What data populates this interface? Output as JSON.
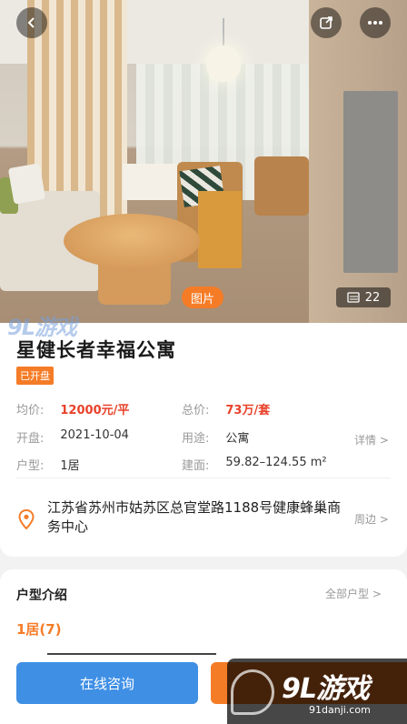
{
  "hero": {
    "photo_tag": "图片",
    "photo_count": "22",
    "watermark": "9L游戏"
  },
  "listing": {
    "title": "星健长者幸福公寓",
    "status": "已开盘",
    "avg_price_label": "均价:",
    "avg_price_value": "12000元/平",
    "total_price_label": "总价:",
    "total_price_value": "73万/套",
    "open_label": "开盘:",
    "open_value": "2021-10-04",
    "usage_label": "用途:",
    "usage_value": "公寓",
    "layout_label": "户型:",
    "layout_value": "1居",
    "area_label": "建面:",
    "area_value": "59.82–124.55 m²",
    "detail_link": "详情 >",
    "address": "江苏省苏州市姑苏区总官堂路1188号健康蜂巢商务中心",
    "nearby_link": "周边 >"
  },
  "units": {
    "heading": "户型介绍",
    "all_link": "全部户型 >",
    "first_tab": "1居(7)"
  },
  "bottom_bar": {
    "consult_label": "在线咨询"
  },
  "watermark": {
    "logo": "9L游戏",
    "url": "91danji.com"
  },
  "colors": {
    "accent": "#f57c27",
    "price_red": "#e8412a",
    "consult_blue": "#3f8fe5"
  }
}
